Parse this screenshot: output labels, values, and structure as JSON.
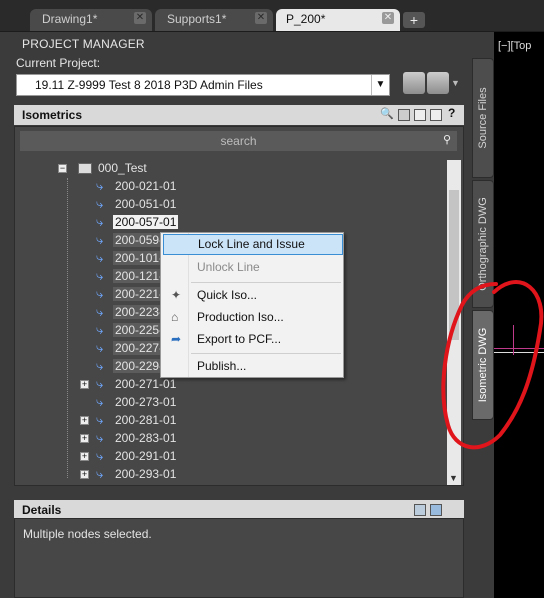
{
  "tabs": [
    {
      "label": "Drawing1*",
      "active": false
    },
    {
      "label": "Supports1*",
      "active": false
    },
    {
      "label": "P_200*",
      "active": true
    }
  ],
  "panel": {
    "title": "PROJECT MANAGER",
    "current_project_label": "Current Project:",
    "current_project_value": "19.11 Z-9999 Test 8 2018 P3D Admin Files"
  },
  "isometrics": {
    "header": "Isometrics",
    "search_placeholder": "search",
    "root": "000_Test",
    "nodes": [
      "200-021-01",
      "200-051-01",
      "200-057-01",
      "200-059-01",
      "200-101-01",
      "200-121-01",
      "200-221-01",
      "200-223-01",
      "200-225-01",
      "200-227-01",
      "200-229-01",
      "200-271-01",
      "200-273-01",
      "200-281-01",
      "200-283-01",
      "200-291-01",
      "200-293-01"
    ]
  },
  "context_menu": {
    "lock_line_and_issue": "Lock Line and Issue",
    "unlock_line": "Unlock Line",
    "quick_iso": "Quick Iso...",
    "production_iso": "Production Iso...",
    "export_to_pcf": "Export to PCF...",
    "publish": "Publish..."
  },
  "details": {
    "header": "Details",
    "message": "Multiple nodes selected."
  },
  "side_tabs": {
    "source_files": "Source Files",
    "orthographic_dwg": "Orthographic DWG",
    "isometric_dwg": "Isometric DWG"
  },
  "viewport": {
    "label": "[−][Top"
  },
  "colors": {
    "annotation": "#e0141b",
    "menu_highlight": "#cce4f7",
    "iso_icon": "#6fa8ff"
  }
}
